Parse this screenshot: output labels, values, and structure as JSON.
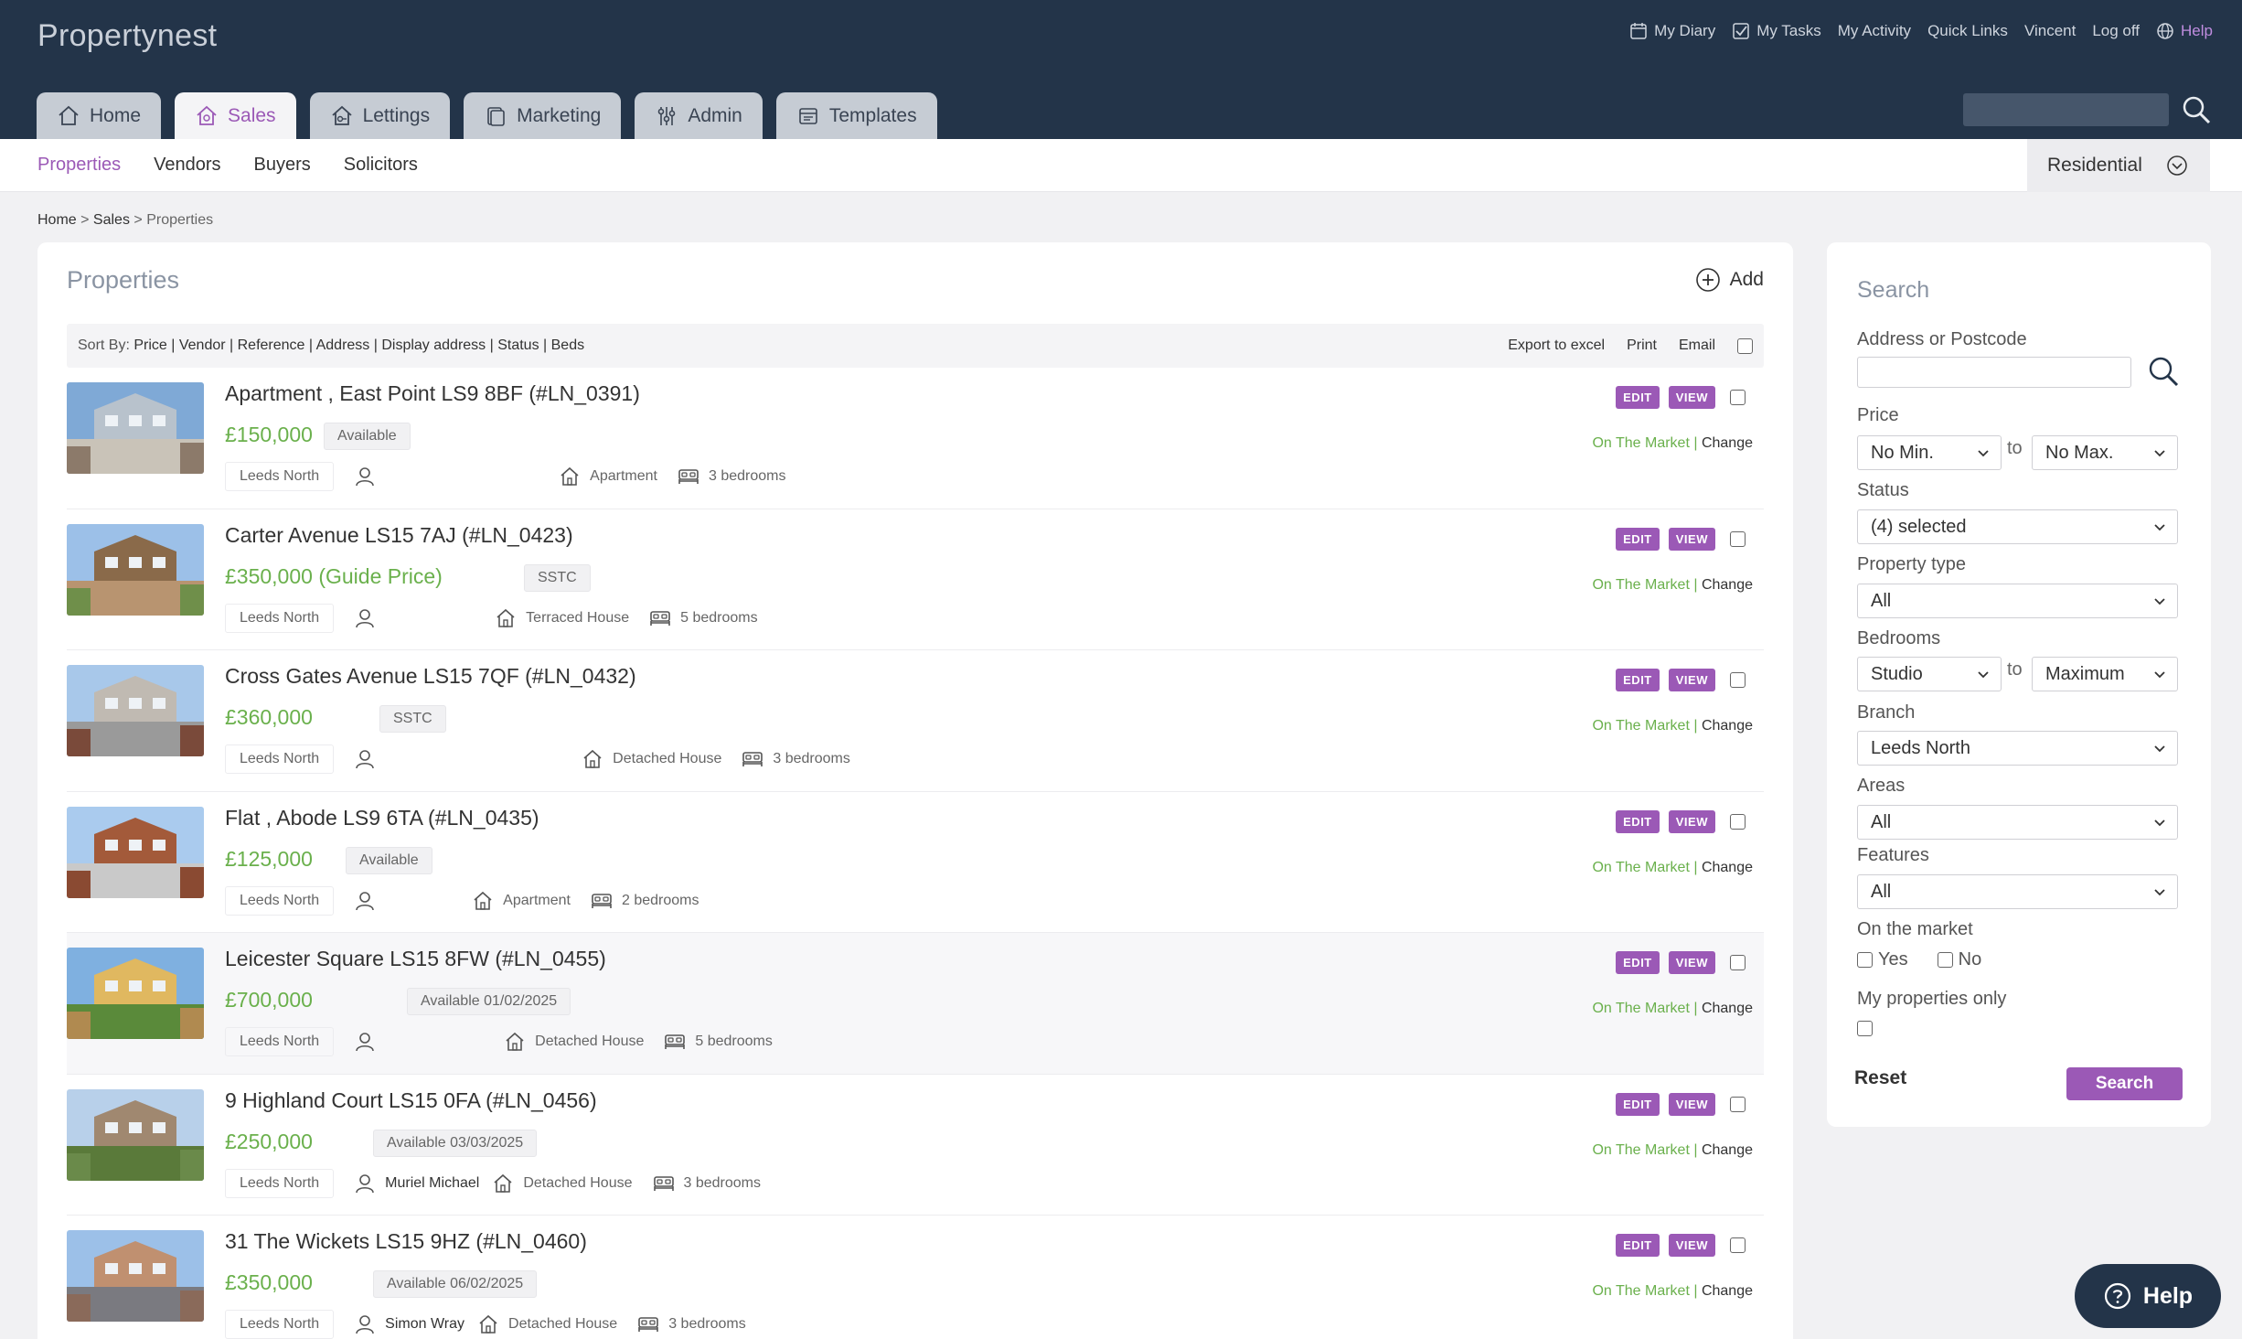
{
  "app": {
    "brand": "Propertynest"
  },
  "toplinks": [
    {
      "label": "My Diary",
      "icon": "calendar-icon"
    },
    {
      "label": "My Tasks",
      "icon": "checkbox-icon"
    },
    {
      "label": "My Activity",
      "icon": ""
    },
    {
      "label": "Quick Links",
      "icon": ""
    },
    {
      "label": "Vincent",
      "icon": ""
    },
    {
      "label": "Log off",
      "icon": ""
    },
    {
      "label": "Help",
      "icon": "globe-icon"
    }
  ],
  "tabs": [
    {
      "label": "Home",
      "icon": "home-icon"
    },
    {
      "label": "Sales",
      "icon": "sales-house-icon"
    },
    {
      "label": "Lettings",
      "icon": "lettings-icon"
    },
    {
      "label": "Marketing",
      "icon": "marketing-icon"
    },
    {
      "label": "Admin",
      "icon": "sliders-icon"
    },
    {
      "label": "Templates",
      "icon": "templates-icon"
    }
  ],
  "subnav": {
    "items": [
      "Properties",
      "Vendors",
      "Buyers",
      "Solicitors"
    ],
    "active": "Properties",
    "market_select": "Residential"
  },
  "breadcrumb": {
    "home": "Home",
    "sales": "Sales",
    "current": "Properties"
  },
  "properties": {
    "title": "Properties",
    "add_label": "Add",
    "sort_prefix": "Sort By:",
    "sort_options": "Price | Vendor | Reference | Address | Display address | Status | Beds",
    "export_label": "Export to excel",
    "print_label": "Print",
    "email_label": "Email",
    "edit_label": "EDIT",
    "view_label": "VIEW",
    "market_label": "On The Market",
    "change_label": "Change",
    "rows": [
      {
        "address": "Apartment       , East Point LS9 8BF (#LN_0391)",
        "price": "£150,000",
        "status": "Available",
        "branch": "Leeds North",
        "owner": "",
        "type": "Apartment",
        "beds": "3 bedrooms"
      },
      {
        "address": " Carter Avenue LS15 7AJ (#LN_0423)",
        "price": "£350,000 (Guide Price)",
        "status": "SSTC",
        "branch": "Leeds North",
        "owner": "",
        "type": "Terraced House",
        "beds": "5 bedrooms"
      },
      {
        "address": " Cross Gates Avenue LS15 7QF (#LN_0432)",
        "price": "£360,000",
        "status": "SSTC",
        "branch": "Leeds North",
        "owner": "",
        "type": "Detached House",
        "beds": "3 bedrooms"
      },
      {
        "address": "Flat      , Abode LS9 6TA (#LN_0435)",
        "price": "£125,000",
        "status": "Available",
        "branch": "Leeds North",
        "owner": "",
        "type": "Apartment",
        "beds": "2 bedrooms"
      },
      {
        "address": "   Leicester Square LS15 8FW (#LN_0455)",
        "price": "£700,000",
        "status": "Available 01/02/2025",
        "branch": "Leeds North",
        "owner": "",
        "type": "Detached House",
        "beds": "5 bedrooms"
      },
      {
        "address": "9 Highland Court LS15 0FA (#LN_0456)",
        "price": "£250,000",
        "status": "Available 03/03/2025",
        "branch": "Leeds North",
        "owner": "Muriel Michael",
        "type": "Detached House",
        "beds": "3 bedrooms"
      },
      {
        "address": "31 The Wickets LS15 9HZ (#LN_0460)",
        "price": "£350,000",
        "status": "Available 06/02/2025",
        "branch": "Leeds North",
        "owner": "Simon Wray",
        "type": "Detached House",
        "beds": "3 bedrooms"
      }
    ]
  },
  "search": {
    "title": "Search",
    "address_label": "Address or Postcode",
    "address_value": "",
    "price_label": "Price",
    "price_min": "No Min.",
    "price_max": "No Max.",
    "to": "to",
    "status_label": "Status",
    "status_value": "(4) selected",
    "ptype_label": "Property type",
    "ptype_value": "All",
    "bedrooms_label": "Bedrooms",
    "bed_min": "Studio",
    "bed_max": "Maximum",
    "branch_label": "Branch",
    "branch_value": "Leeds North",
    "areas_label": "Areas",
    "areas_value": "All",
    "features_label": "Features",
    "features_value": "All",
    "market_label": "On the market",
    "yes": "Yes",
    "no": "No",
    "mine_label": "My properties only",
    "reset": "Reset",
    "search_btn": "Search"
  },
  "help_fab": "Help",
  "colors": {
    "topbar": "#233449",
    "accent": "#9b59b6",
    "price_green": "#6ab04c"
  }
}
